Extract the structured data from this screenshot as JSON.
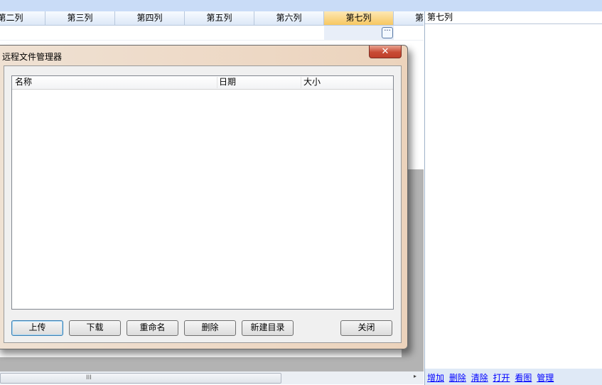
{
  "grid": {
    "columns": [
      "第二列",
      "第三列",
      "第四列",
      "第五列",
      "第六列",
      "第七列",
      "第"
    ],
    "selected_column": "第七列",
    "ellipsis_button": "···"
  },
  "right_panel": {
    "title": "第七列",
    "links": [
      "增加",
      "删除",
      "清除",
      "打开",
      "看图",
      "管理"
    ]
  },
  "dialog": {
    "title": "远程文件管理器",
    "close_glyph": "✕",
    "list_columns": {
      "name": "名称",
      "date": "日期",
      "size": "大小"
    },
    "buttons": {
      "upload": "上传",
      "download": "下载",
      "rename": "重命名",
      "delete": "删除",
      "new_folder": "新建目录",
      "close": "关闭"
    }
  },
  "scrollbar": {
    "grip": "III",
    "right_arrow": "▸"
  }
}
